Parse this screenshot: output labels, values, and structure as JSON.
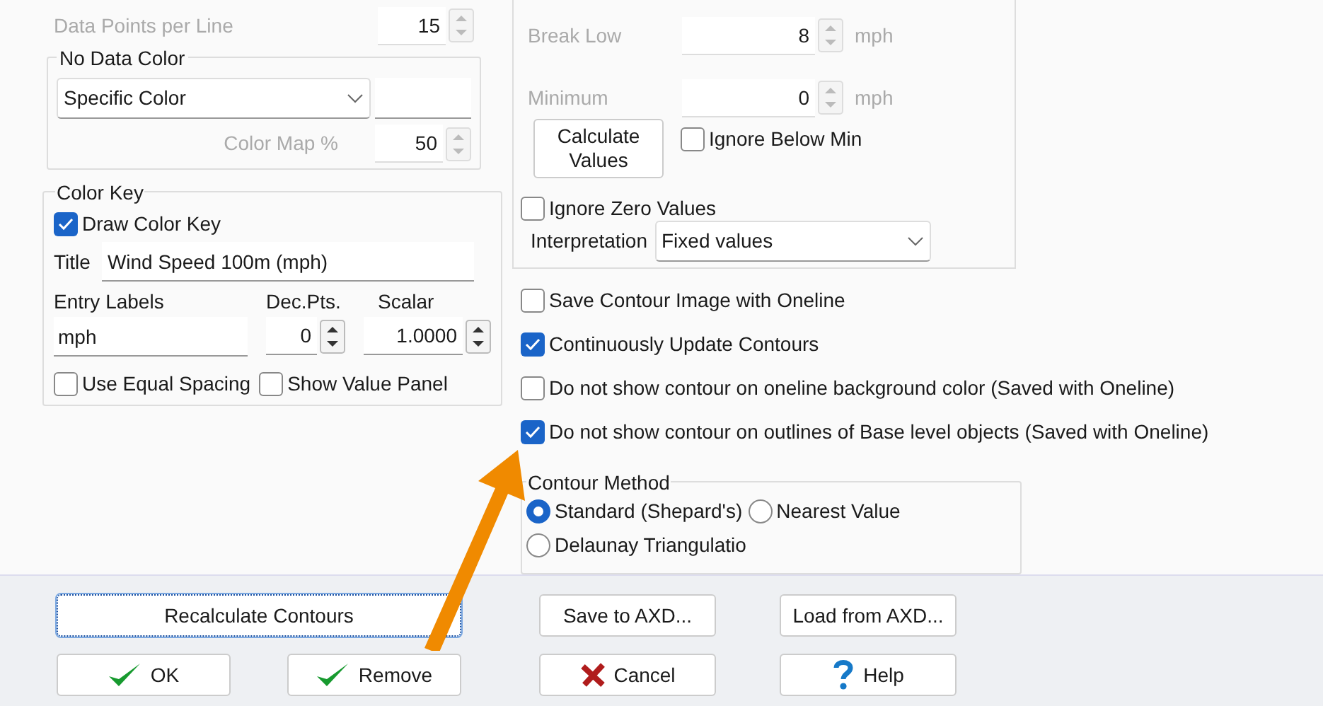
{
  "data_points_per_line": {
    "label": "Data Points per Line",
    "value": "15",
    "disabled": true
  },
  "no_data_color": {
    "title": "No Data Color",
    "mode": "Specific Color",
    "color_map": {
      "label": "Color Map %",
      "value": "50",
      "disabled": true
    }
  },
  "color_key": {
    "title": "Color Key",
    "draw": {
      "label": "Draw Color Key",
      "checked": true
    },
    "title_field": {
      "label": "Title",
      "value": "Wind Speed 100m (mph)"
    },
    "entry_labels": {
      "label": "Entry Labels",
      "value": "mph"
    },
    "dec_pts": {
      "label": "Dec.Pts.",
      "value": "0"
    },
    "scalar": {
      "label": "Scalar",
      "value": "1.0000"
    },
    "options": [
      {
        "label": "Use Equal Spacing",
        "checked": false
      },
      {
        "label": "Show Value Panel",
        "checked": false
      }
    ]
  },
  "breaks": [
    {
      "label": "Break Low",
      "value": "8",
      "unit": "mph",
      "disabled": true
    },
    {
      "label": "Minimum",
      "value": "0",
      "unit": "mph",
      "disabled": true
    }
  ],
  "calculate_button": "Calculate Values",
  "ignore_below_min": {
    "label": "Ignore Below Min",
    "checked": false
  },
  "ignore_zero_values": {
    "label": "Ignore Zero Values",
    "checked": false
  },
  "interpretation": {
    "label": "Interpretation",
    "value": "Fixed values"
  },
  "options": [
    {
      "label": "Save Contour Image with Oneline",
      "checked": false
    },
    {
      "label": "Continuously Update Contours",
      "checked": true
    },
    {
      "label": "Do not show contour on oneline background color (Saved with Oneline)",
      "checked": false
    },
    {
      "label": "Do not show contour on outlines of Base level objects (Saved with Oneline)",
      "checked": true
    }
  ],
  "contour_method": {
    "title": "Contour Method",
    "options": [
      {
        "label": "Standard (Shepard's)",
        "selected": true
      },
      {
        "label": "Nearest Value",
        "selected": false
      },
      {
        "label": "Delaunay Triangulatio",
        "selected": false
      }
    ]
  },
  "buttons_row_1": [
    {
      "label": "Recalculate Contours",
      "focused": true
    },
    {
      "label": "Save to AXD...",
      "focused": false
    },
    {
      "label": "Load from AXD...",
      "focused": false
    }
  ],
  "buttons_row_2": [
    {
      "label": "OK",
      "kind": "ok"
    },
    {
      "label": "Remove",
      "kind": "remove"
    },
    {
      "label": "Cancel",
      "kind": "cancel"
    },
    {
      "label": "Help",
      "kind": "help"
    }
  ]
}
